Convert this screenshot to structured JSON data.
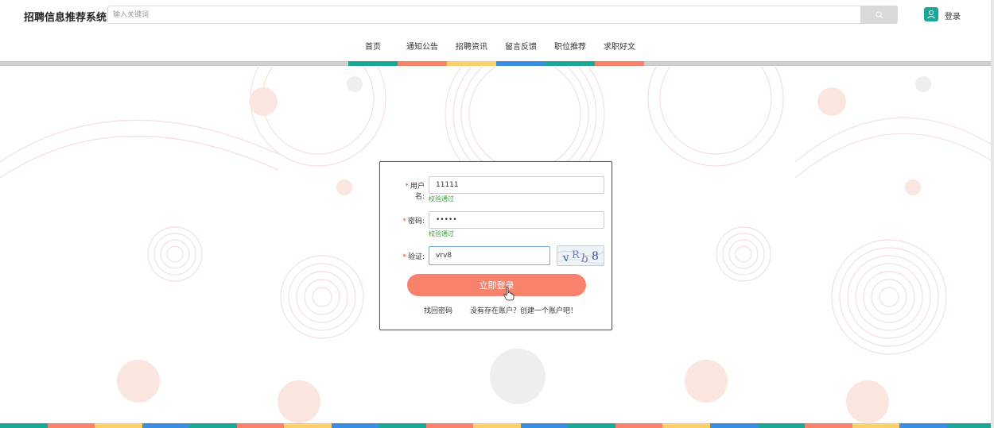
{
  "header": {
    "brand": "招聘信息推荐系统",
    "search_placeholder": "输入关键词",
    "login": "登录"
  },
  "nav": {
    "items": [
      {
        "label": "首页",
        "color": "#1aa899"
      },
      {
        "label": "通知公告",
        "color": "#f8826c"
      },
      {
        "label": "招聘资讯",
        "color": "#f9cf6f"
      },
      {
        "label": "留言反馈",
        "color": "#3d8ede"
      },
      {
        "label": "职位推荐",
        "color": "#1aa899"
      },
      {
        "label": "求职好文",
        "color": "#f8826c"
      }
    ]
  },
  "login_form": {
    "username_label": "用户名:",
    "username_value": "11111",
    "username_hint": "校验通过",
    "password_label": "密码:",
    "password_value": "•••••",
    "password_hint": "校验通过",
    "captcha_label": "验证:",
    "captcha_value": "vrv8",
    "submit": "立即登录",
    "forgot_link": "找回密码",
    "register_link": "没有存在账户？创建一个账户吧！"
  },
  "stripe_colors": [
    "#1aa899",
    "#f8826c",
    "#f9cf6f",
    "#3d8ede"
  ]
}
